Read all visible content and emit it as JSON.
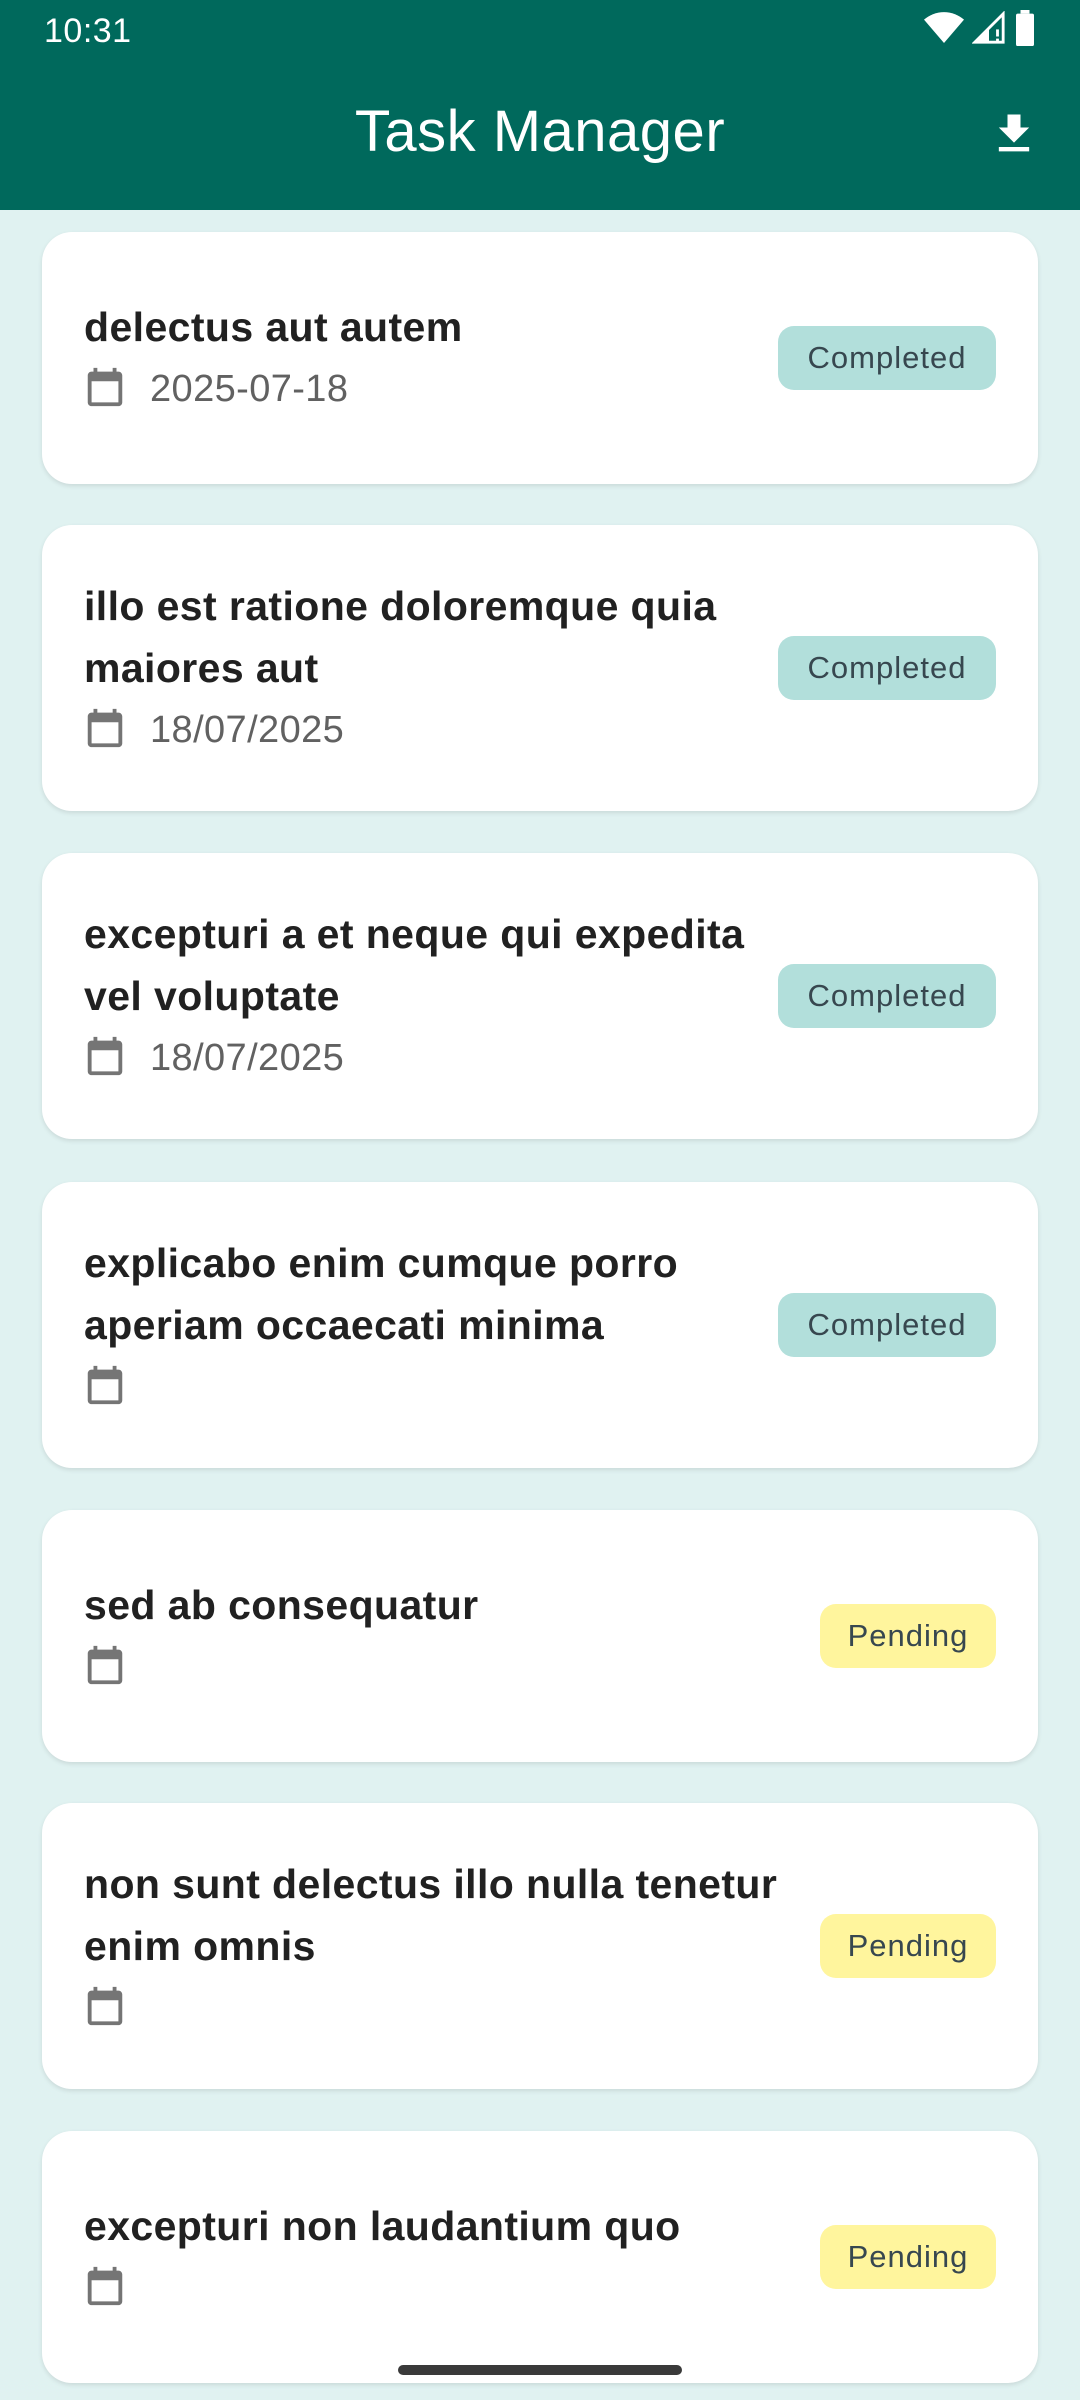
{
  "status_bar": {
    "time": "10:31",
    "icons": [
      "wifi-icon",
      "signal-icon",
      "battery-icon"
    ]
  },
  "app_bar": {
    "title": "Task Manager",
    "action_icon": "download-icon"
  },
  "colors": {
    "app_bar": "#00695C",
    "background": "#E0F2F1",
    "completed_badge": "#B2DFDB",
    "pending_badge": "#FFF59D"
  },
  "tasks": [
    {
      "title": "delectus aut autem",
      "date": "2025-07-18",
      "status": "Completed"
    },
    {
      "title": "illo est ratione doloremque quia maiores aut",
      "date": "18/07/2025",
      "status": "Completed"
    },
    {
      "title": "excepturi a et neque qui expedita vel voluptate",
      "date": "18/07/2025",
      "status": "Completed"
    },
    {
      "title": "explicabo enim cumque porro aperiam occaecati minima",
      "date": "",
      "status": "Completed"
    },
    {
      "title": "sed ab consequatur",
      "date": "",
      "status": "Pending"
    },
    {
      "title": "non sunt delectus illo nulla tenetur enim omnis",
      "date": "",
      "status": "Pending"
    },
    {
      "title": "excepturi non laudantium quo",
      "date": "",
      "status": "Pending"
    }
  ]
}
